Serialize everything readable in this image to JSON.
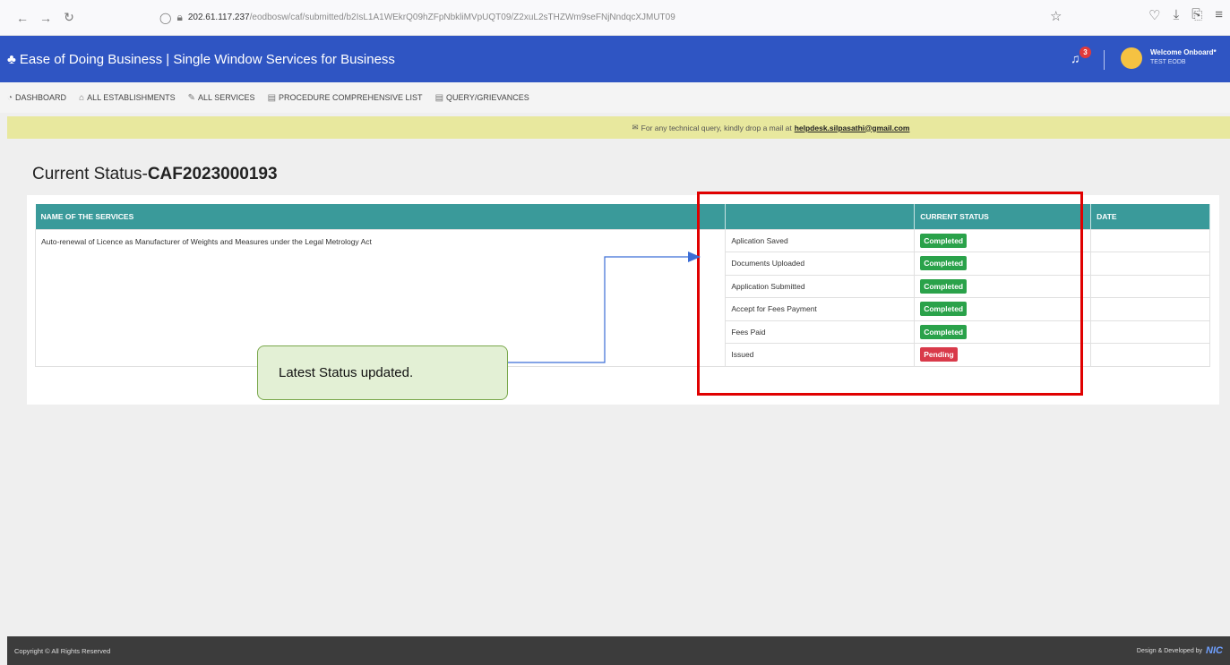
{
  "browser": {
    "url_host": "202.61.117.237",
    "url_path": "/eodbosw/caf/submitted/b2IsL1A1WEkrQ09hZFpNbkliMVpUQT09/Z2xuL2sTHZWm9seFNjNndqcXJMUT09"
  },
  "header": {
    "title": "Ease of Doing Business | Single Window Services for Business",
    "notification_count": "3",
    "welcome": "Welcome Onboard*",
    "user": "TEST EODB"
  },
  "nav": [
    {
      "label": "DASHBOARD",
      "icon": "dashboard-icon"
    },
    {
      "label": "ALL ESTABLISHMENTS",
      "icon": "building-icon"
    },
    {
      "label": "ALL SERVICES",
      "icon": "wrench-icon"
    },
    {
      "label": "PROCEDURE COMPREHENSIVE LIST",
      "icon": "list-icon"
    },
    {
      "label": "QUERY/GRIEVANCES",
      "icon": "list-icon"
    }
  ],
  "notice": {
    "text": "For any technical query, kindly drop a mail at",
    "email": "helpdesk.silpasathi@gmail.com"
  },
  "page": {
    "title_prefix": "Current Status-",
    "title_id": "CAF2023000193"
  },
  "table": {
    "headers": [
      "NAME OF THE SERVICES",
      "",
      "CURRENT STATUS",
      "DATE"
    ],
    "service_name": "Auto-renewal of Licence as Manufacturer of Weights and Measures under the Legal Metrology Act",
    "steps": [
      {
        "step": "Aplication Saved",
        "status": "Completed",
        "date": ""
      },
      {
        "step": "Documents Uploaded",
        "status": "Completed",
        "date": ""
      },
      {
        "step": "Application Submitted",
        "status": "Completed",
        "date": ""
      },
      {
        "step": "Accept for Fees Payment",
        "status": "Completed",
        "date": ""
      },
      {
        "step": "Fees Paid",
        "status": "Completed",
        "date": ""
      },
      {
        "step": "Issued",
        "status": "Pending",
        "date": ""
      }
    ]
  },
  "callout": {
    "text": "Latest Status updated."
  },
  "footer": {
    "copyright": "Copyright © All Rights Reserved",
    "designed_by": "Design & Developed by",
    "brand": "NIC"
  },
  "colors": {
    "header_bg": "#2f55c3",
    "table_header": "#3a9a9a",
    "completed": "#2aa24a",
    "pending": "#d93a4a",
    "highlight": "#e00000"
  }
}
